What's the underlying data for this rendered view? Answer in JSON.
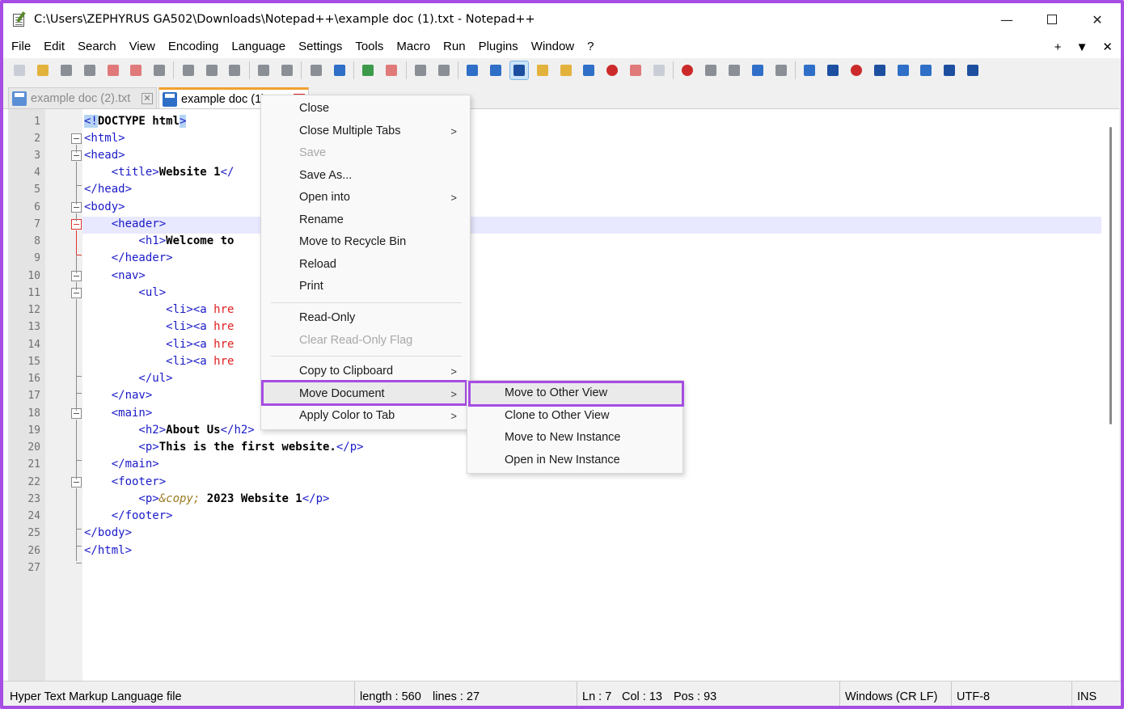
{
  "window": {
    "title": "C:\\Users\\ZEPHYRUS GA502\\Downloads\\Notepad++\\example doc (1).txt - Notepad++",
    "minimize": "—",
    "close": "✕"
  },
  "menubar": {
    "items": [
      "File",
      "Edit",
      "Search",
      "View",
      "Encoding",
      "Language",
      "Settings",
      "Tools",
      "Macro",
      "Run",
      "Plugins",
      "Window",
      "?"
    ],
    "right": [
      "+",
      "▼",
      "✕"
    ]
  },
  "tabs": [
    {
      "label": "example doc (2).txt",
      "close": "✕"
    },
    {
      "label": "example doc (1).txt",
      "close": "✕"
    }
  ],
  "editor": {
    "line_numbers": [
      "1",
      "2",
      "3",
      "4",
      "5",
      "6",
      "7",
      "8",
      "9",
      "10",
      "11",
      "12",
      "13",
      "14",
      "15",
      "16",
      "17",
      "18",
      "19",
      "20",
      "21",
      "22",
      "23",
      "24",
      "25",
      "26",
      "27"
    ],
    "lines": {
      "l1a": "<!",
      "l1b": "DOCTYPE html",
      "l1c": ">",
      "l2": "<html>",
      "l3": "<head>",
      "l4a": "    <title>",
      "l4b": "Website 1",
      "l4c": "</",
      "l5": "</head>",
      "l6": "<body>",
      "l7": "    <header>",
      "l8a": "        <h1>",
      "l8b": "Welcome to",
      "l9": "    </header>",
      "l10": "    <nav>",
      "l11": "        <ul>",
      "l12a": "            <li><a ",
      "l12b": "hre",
      "l13a": "            <li><a ",
      "l13b": "hre",
      "l14a": "            <li><a ",
      "l14b": "hre",
      "l15a": "            <li><a ",
      "l15b": "hre",
      "l16": "        </ul>",
      "l17": "    </nav>",
      "l18": "    <main>",
      "l19a": "        <h2>",
      "l19b": "About Us",
      "l19c": "</h2>",
      "l20a": "        <p>",
      "l20b": "This is the first website.",
      "l20c": "</p>",
      "l21": "    </main>",
      "l22": "    <footer>",
      "l23a": "        <p>",
      "l23b": "&copy;",
      "l23c": " 2023 Website 1",
      "l23d": "</p>",
      "l24": "    </footer>",
      "l25": "</body>",
      "l26": "</html>"
    }
  },
  "context_menu": {
    "items": [
      {
        "label": "Close"
      },
      {
        "label": "Close Multiple Tabs",
        "arrow": ">"
      },
      {
        "label": "Save"
      },
      {
        "label": "Save As..."
      },
      {
        "label": "Open into",
        "arrow": ">"
      },
      {
        "label": "Rename"
      },
      {
        "label": "Move to Recycle Bin"
      },
      {
        "label": "Reload"
      },
      {
        "label": "Print"
      },
      {
        "label": "Read-Only"
      },
      {
        "label": "Clear Read-Only Flag"
      },
      {
        "label": "Copy to Clipboard",
        "arrow": ">"
      },
      {
        "label": "Move Document",
        "arrow": ">"
      },
      {
        "label": "Apply Color to Tab",
        "arrow": ">"
      }
    ]
  },
  "submenu": {
    "items": [
      {
        "label": "Move to Other View"
      },
      {
        "label": "Clone to Other View"
      },
      {
        "label": "Move to New Instance"
      },
      {
        "label": "Open in New Instance"
      }
    ]
  },
  "statusbar": {
    "type": "Hyper Text Markup Language file",
    "length": "length : 560",
    "lines": "lines : 27",
    "ln": "Ln : 7",
    "col": "Col : 13",
    "pos": "Pos : 93",
    "eol": "Windows (CR LF)",
    "encoding": "UTF-8",
    "mode": "INS"
  },
  "colors": {
    "highlight_border": "#a64de3",
    "tag": "#1a1ac8",
    "attribute": "#e02020",
    "current_line": "#e8e8ff"
  }
}
